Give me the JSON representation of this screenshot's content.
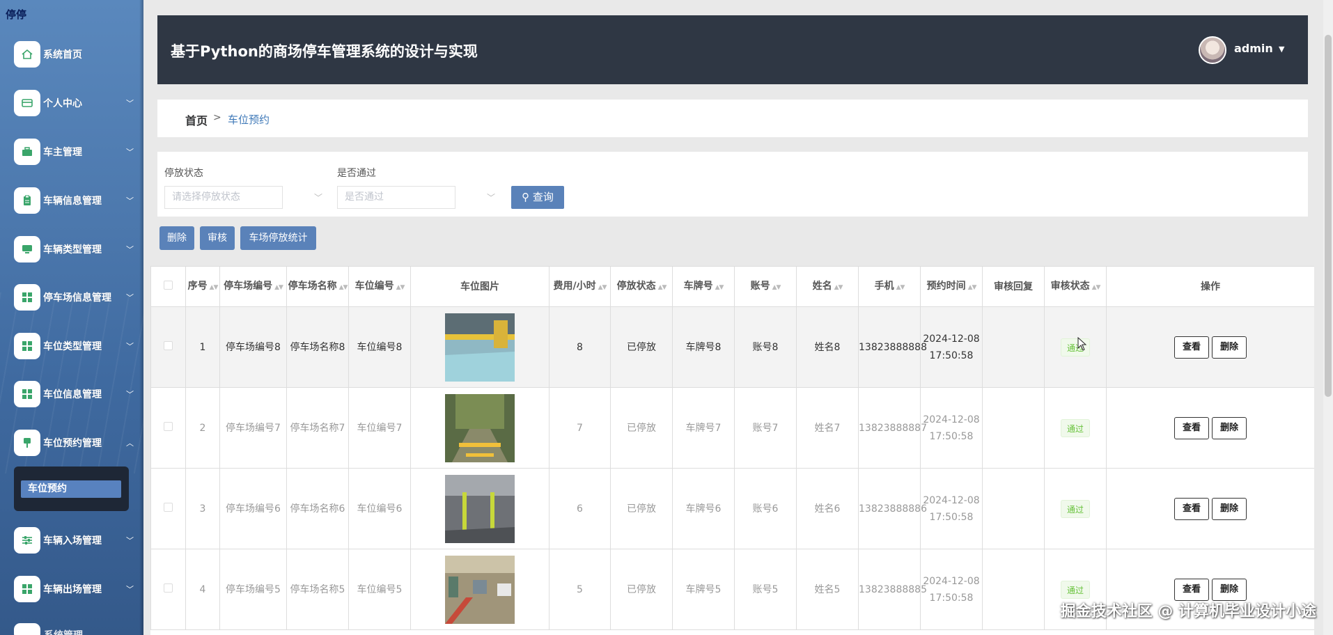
{
  "sidebar": {
    "logo": "停停",
    "items": [
      {
        "label": "系统首页",
        "icon": "home-icon",
        "chevron": false
      },
      {
        "label": "个人中心",
        "icon": "card-icon",
        "chevron": true
      },
      {
        "label": "车主管理",
        "icon": "briefcase-icon",
        "chevron": true
      },
      {
        "label": "车辆信息管理",
        "icon": "clipboard-icon",
        "chevron": true
      },
      {
        "label": "车辆类型管理",
        "icon": "monitor-icon",
        "chevron": true
      },
      {
        "label": "停车场信息管理",
        "icon": "grid-icon",
        "chevron": true
      },
      {
        "label": "车位类型管理",
        "icon": "grid-icon",
        "chevron": true
      },
      {
        "label": "车位信息管理",
        "icon": "grid-icon",
        "chevron": true
      },
      {
        "label": "车位预约管理",
        "icon": "pin-icon",
        "chevron": true,
        "expanded": true
      },
      {
        "label": "车辆入场管理",
        "icon": "sliders-icon",
        "chevron": true
      },
      {
        "label": "车辆出场管理",
        "icon": "grid-icon",
        "chevron": true
      }
    ],
    "submenu": {
      "label": "车位预约"
    },
    "partial_item_label": "系统管理"
  },
  "header": {
    "title": "基于Python的商场停车管理系统的设计与实现",
    "user": "admin"
  },
  "breadcrumb": {
    "home": "首页",
    "separator": ">",
    "current": "车位预约"
  },
  "filters": {
    "status_label": "停放状态",
    "status_placeholder": "请选择停放状态",
    "pass_label": "是否通过",
    "pass_placeholder": "是否通过",
    "query_label": "查询"
  },
  "actions": {
    "delete": "删除",
    "audit": "审核",
    "stats": "车场停放统计"
  },
  "table": {
    "headers": [
      "序号",
      "停车场编号",
      "停车场名称",
      "车位编号",
      "车位图片",
      "费用/小时",
      "停放状态",
      "车牌号",
      "账号",
      "姓名",
      "手机",
      "预约时间",
      "审核回复",
      "审核状态",
      "操作"
    ],
    "rows": [
      {
        "no": "1",
        "lot_no": "停车场编号8",
        "lot_name": "停车场名称8",
        "space_no": "车位编号8",
        "fee": "8",
        "state": "已停放",
        "plate": "车牌号8",
        "account": "账号8",
        "name": "姓名8",
        "phone": "13823888888",
        "time": "2024-12-08 17:50:58",
        "reply": "",
        "audit": "通过"
      },
      {
        "no": "2",
        "lot_no": "停车场编号7",
        "lot_name": "停车场名称7",
        "space_no": "车位编号7",
        "fee": "7",
        "state": "已停放",
        "plate": "车牌号7",
        "account": "账号7",
        "name": "姓名7",
        "phone": "13823888887",
        "time": "2024-12-08 17:50:58",
        "reply": "",
        "audit": "通过"
      },
      {
        "no": "3",
        "lot_no": "停车场编号6",
        "lot_name": "停车场名称6",
        "space_no": "车位编号6",
        "fee": "6",
        "state": "已停放",
        "plate": "车牌号6",
        "account": "账号6",
        "name": "姓名6",
        "phone": "13823888886",
        "time": "2024-12-08 17:50:58",
        "reply": "",
        "audit": "通过"
      },
      {
        "no": "4",
        "lot_no": "停车场编号5",
        "lot_name": "停车场名称5",
        "space_no": "车位编号5",
        "fee": "5",
        "state": "已停放",
        "plate": "车牌号5",
        "account": "账号5",
        "name": "姓名5",
        "phone": "13823888885",
        "time": "2024-12-08 17:50:58",
        "reply": "",
        "audit": "通过"
      }
    ],
    "view_label": "查看",
    "delete_label": "删除"
  },
  "watermark": "掘金技术社区 @ 计算机毕业设计小途",
  "colors": {
    "sidebar": "#4c78ad",
    "header": "#2f3744",
    "primary_button": "#5a82b9",
    "link": "#3f79b8",
    "pass_tag": "#67c23a"
  }
}
